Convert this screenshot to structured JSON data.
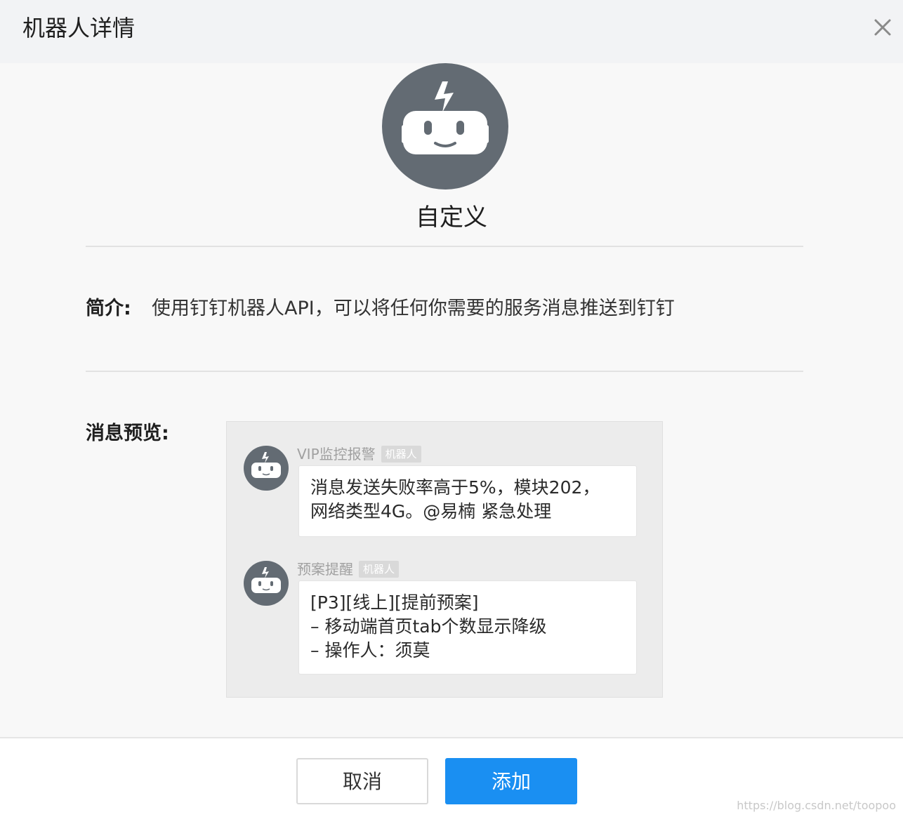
{
  "header": {
    "title": "机器人详情"
  },
  "robot": {
    "name": "自定义",
    "avatar_icon": "robot-icon",
    "avatar_color": "#636b73"
  },
  "intro": {
    "label": "简介:",
    "text": "使用钉钉机器人API，可以将任何你需要的服务消息推送到钉钉"
  },
  "preview": {
    "label": "消息预览:",
    "messages": [
      {
        "sender": "VIP监控报警",
        "badge": "机器人",
        "lines": [
          "消息发送失败率高于5%，模块202，",
          "网络类型4G。@易楠 紧急处理"
        ]
      },
      {
        "sender": "预案提醒",
        "badge": "机器人",
        "lines": [
          "[P3][线上][提前预案]",
          "– 移动端首页tab个数显示降级",
          "– 操作人：须莫"
        ]
      }
    ]
  },
  "footer": {
    "cancel_label": "取消",
    "add_label": "添加"
  },
  "watermark": "https://blog.csdn.net/toopoo",
  "colors": {
    "primary": "#1a8ff2",
    "avatar": "#636b73"
  }
}
